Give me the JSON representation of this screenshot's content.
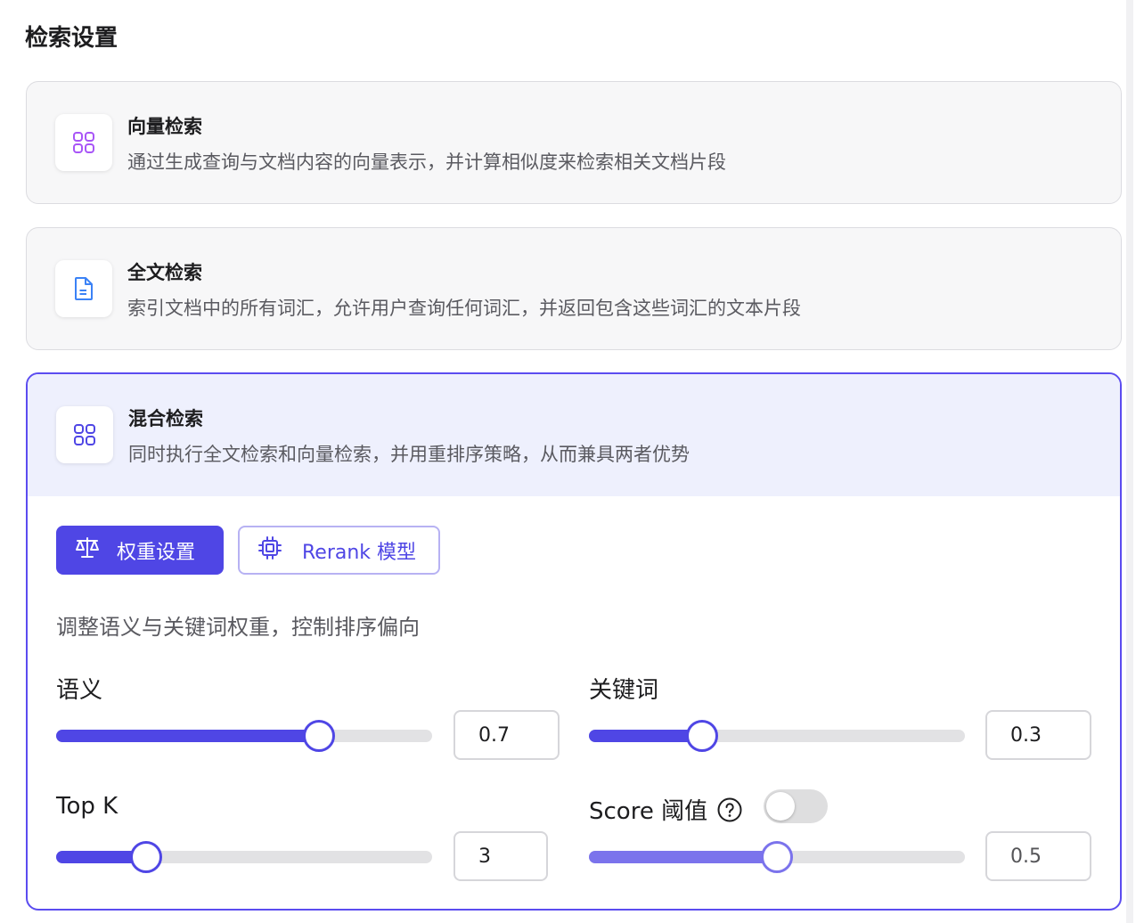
{
  "page": {
    "title": "检索设置"
  },
  "modes": {
    "vector": {
      "title": "向量检索",
      "desc": "通过生成查询与文档内容的向量表示，并计算相似度来检索相关文档片段",
      "icon": "grid-icon"
    },
    "fulltext": {
      "title": "全文检索",
      "desc": "索引文档中的所有词汇，允许用户查询任何词汇，并返回包含这些词汇的文本片段",
      "icon": "document-icon"
    },
    "hybrid": {
      "title": "混合检索",
      "desc": "同时执行全文检索和向量检索，并用重排序策略，从而兼具两者优势",
      "icon": "grid-icon",
      "selected": true
    }
  },
  "tabs": {
    "weight": {
      "label": "权重设置",
      "icon": "scale-icon",
      "active": true
    },
    "rerank": {
      "label": "Rerank 模型",
      "icon": "chip-icon",
      "active": false
    }
  },
  "weight_hint": "调整语义与关键词权重，控制排序偏向",
  "settings": {
    "semantic": {
      "label": "语义",
      "value": "0.7",
      "fraction": 0.7
    },
    "keyword": {
      "label": "关键词",
      "value": "0.3",
      "fraction": 0.3
    },
    "top_k": {
      "label": "Top K",
      "value": "3",
      "fraction": 0.24
    },
    "score": {
      "label": "Score 阈值",
      "value": "0.5",
      "fraction": 0.5,
      "enabled": false
    }
  },
  "colors": {
    "accent": "#4f46e5",
    "selected_border": "#5b4cf0",
    "vector_icon": "#a855f7",
    "doc_icon": "#3b82f6"
  }
}
